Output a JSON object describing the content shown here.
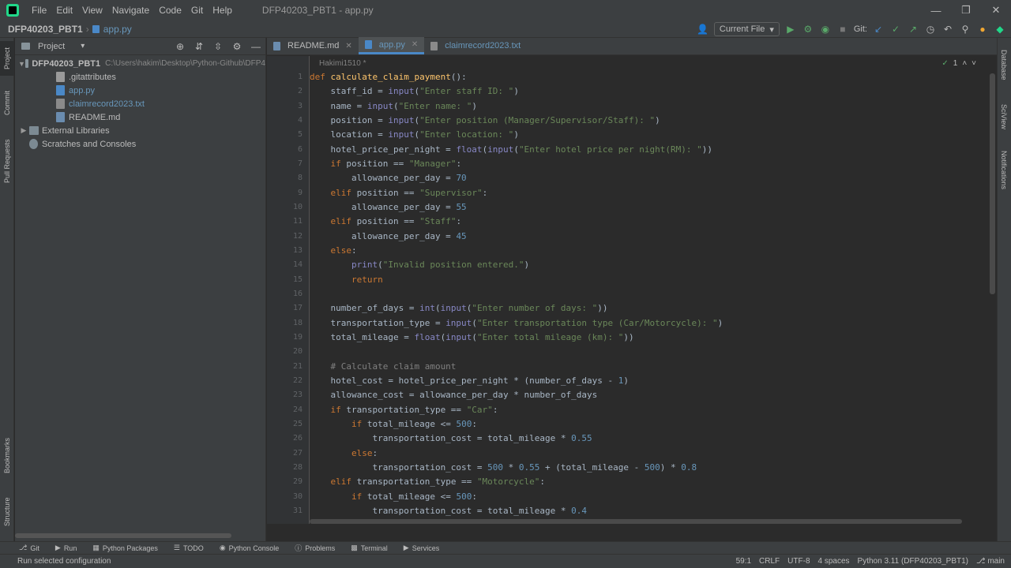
{
  "menu": [
    "File",
    "Edit",
    "View",
    "Navigate",
    "Code",
    "Git",
    "Help"
  ],
  "window_title": "DFP40203_PBT1 - app.py",
  "breadcrumb": {
    "project": "DFP40203_PBT1",
    "file": "app.py"
  },
  "toolbar": {
    "run_config": "Current File",
    "git_label": "Git:"
  },
  "project_panel": {
    "title": "Project",
    "root_name": "DFP40203_PBT1",
    "root_path": "C:\\Users\\hakim\\Desktop\\Python-Github\\DFP4",
    "items": [
      ".gitattributes",
      "app.py",
      "claimrecord2023.txt",
      "README.md"
    ],
    "external": "External Libraries",
    "scratches": "Scratches and Consoles"
  },
  "left_tabs": [
    "Project",
    "Commit",
    "Pull Requests",
    "Bookmarks",
    "Structure"
  ],
  "right_tabs": [
    "Database",
    "SciView",
    "Notifications"
  ],
  "tabs": [
    {
      "label": "README.md"
    },
    {
      "label": "app.py"
    },
    {
      "label": "claimrecord2023.txt"
    }
  ],
  "editor": {
    "author": "Hakimi1510 *",
    "inspections": "1",
    "line_numbers": [
      "1",
      "2",
      "3",
      "4",
      "5",
      "6",
      "7",
      "8",
      "9",
      "10",
      "11",
      "12",
      "13",
      "14",
      "15",
      "16",
      "17",
      "18",
      "19",
      "20",
      "21",
      "22",
      "23",
      "24",
      "25",
      "26",
      "27",
      "28",
      "29",
      "30",
      "31"
    ]
  },
  "bottom_tools": [
    "Git",
    "Run",
    "Python Packages",
    "TODO",
    "Python Console",
    "Problems",
    "Terminal",
    "Services"
  ],
  "status": {
    "message": "Run selected configuration",
    "position": "59:1",
    "line_sep": "CRLF",
    "encoding": "UTF-8",
    "indent": "4 spaces",
    "interpreter": "Python 3.11 (DFP40203_PBT1)",
    "branch": "main"
  },
  "code": [
    [
      [
        "kw",
        "def "
      ],
      [
        "fn",
        "calculate_claim_payment"
      ],
      [
        "",
        "():"
      ]
    ],
    [
      [
        "",
        "    staff_id = "
      ],
      [
        "bi",
        "input"
      ],
      [
        "",
        "("
      ],
      [
        "st",
        "\"Enter staff ID: \""
      ],
      [
        "",
        ")"
      ]
    ],
    [
      [
        "",
        "    name = "
      ],
      [
        "bi",
        "input"
      ],
      [
        "",
        "("
      ],
      [
        "st",
        "\"Enter name: \""
      ],
      [
        "",
        ")"
      ]
    ],
    [
      [
        "",
        "    position = "
      ],
      [
        "bi",
        "input"
      ],
      [
        "",
        "("
      ],
      [
        "st",
        "\"Enter position (Manager/Supervisor/Staff): \""
      ],
      [
        "",
        ")"
      ]
    ],
    [
      [
        "",
        "    location = "
      ],
      [
        "bi",
        "input"
      ],
      [
        "",
        "("
      ],
      [
        "st",
        "\"Enter location: \""
      ],
      [
        "",
        ")"
      ]
    ],
    [
      [
        "",
        "    hotel_price_per_night = "
      ],
      [
        "bi",
        "float"
      ],
      [
        "",
        "("
      ],
      [
        "bi",
        "input"
      ],
      [
        "",
        "("
      ],
      [
        "st",
        "\"Enter hotel price per night(RM): \""
      ],
      [
        "",
        "))"
      ]
    ],
    [
      [
        "kw",
        "    if "
      ],
      [
        "",
        "position == "
      ],
      [
        "st",
        "\"Manager\""
      ],
      [
        "",
        ":"
      ]
    ],
    [
      [
        "",
        "        allowance_per_day = "
      ],
      [
        "nm",
        "70"
      ]
    ],
    [
      [
        "kw",
        "    elif "
      ],
      [
        "",
        "position == "
      ],
      [
        "st",
        "\"Supervisor\""
      ],
      [
        "",
        ":"
      ]
    ],
    [
      [
        "",
        "        allowance_per_day = "
      ],
      [
        "nm",
        "55"
      ]
    ],
    [
      [
        "kw",
        "    elif "
      ],
      [
        "",
        "position == "
      ],
      [
        "st",
        "\"Staff\""
      ],
      [
        "",
        ":"
      ]
    ],
    [
      [
        "",
        "        allowance_per_day = "
      ],
      [
        "nm",
        "45"
      ]
    ],
    [
      [
        "kw",
        "    else"
      ],
      [
        "",
        ":"
      ]
    ],
    [
      [
        "",
        "        "
      ],
      [
        "bi",
        "print"
      ],
      [
        "",
        "("
      ],
      [
        "st",
        "\"Invalid position entered.\""
      ],
      [
        "",
        ")"
      ]
    ],
    [
      [
        "kw",
        "        return"
      ]
    ],
    [
      [
        "",
        ""
      ]
    ],
    [
      [
        "",
        "    number_of_days = "
      ],
      [
        "bi",
        "int"
      ],
      [
        "",
        "("
      ],
      [
        "bi",
        "input"
      ],
      [
        "",
        "("
      ],
      [
        "st",
        "\"Enter number of days: \""
      ],
      [
        "",
        "))"
      ]
    ],
    [
      [
        "",
        "    transportation_type = "
      ],
      [
        "bi",
        "input"
      ],
      [
        "",
        "("
      ],
      [
        "st",
        "\"Enter transportation type (Car/Motorcycle): \""
      ],
      [
        "",
        ")"
      ]
    ],
    [
      [
        "",
        "    total_mileage = "
      ],
      [
        "bi",
        "float"
      ],
      [
        "",
        "("
      ],
      [
        "bi",
        "input"
      ],
      [
        "",
        "("
      ],
      [
        "st",
        "\"Enter total mileage (km): \""
      ],
      [
        "",
        "))"
      ]
    ],
    [
      [
        "",
        ""
      ]
    ],
    [
      [
        "cm",
        "    # Calculate claim amount"
      ]
    ],
    [
      [
        "",
        "    hotel_cost = hotel_price_per_night * (number_of_days - "
      ],
      [
        "nm",
        "1"
      ],
      [
        "",
        ")"
      ]
    ],
    [
      [
        "",
        "    allowance_cost = allowance_per_day * number_of_days"
      ]
    ],
    [
      [
        "kw",
        "    if "
      ],
      [
        "",
        "transportation_type == "
      ],
      [
        "st",
        "\"Car\""
      ],
      [
        "",
        ":"
      ]
    ],
    [
      [
        "kw",
        "        if "
      ],
      [
        "",
        "total_mileage <= "
      ],
      [
        "nm",
        "500"
      ],
      [
        "",
        ":"
      ]
    ],
    [
      [
        "",
        "            transportation_cost = total_mileage * "
      ],
      [
        "nm",
        "0.55"
      ]
    ],
    [
      [
        "kw",
        "        else"
      ],
      [
        "",
        ":"
      ]
    ],
    [
      [
        "",
        "            transportation_cost = "
      ],
      [
        "nm",
        "500"
      ],
      [
        "",
        " * "
      ],
      [
        "nm",
        "0.55"
      ],
      [
        "",
        " + (total_mileage - "
      ],
      [
        "nm",
        "500"
      ],
      [
        "",
        ") * "
      ],
      [
        "nm",
        "0.8"
      ]
    ],
    [
      [
        "kw",
        "    elif "
      ],
      [
        "",
        "transportation_type == "
      ],
      [
        "st",
        "\"Motorcycle\""
      ],
      [
        "",
        ":"
      ]
    ],
    [
      [
        "kw",
        "        if "
      ],
      [
        "",
        "total_mileage <= "
      ],
      [
        "nm",
        "500"
      ],
      [
        "",
        ":"
      ]
    ],
    [
      [
        "",
        "            transportation_cost = total_mileage * "
      ],
      [
        "nm",
        "0.4"
      ]
    ]
  ]
}
